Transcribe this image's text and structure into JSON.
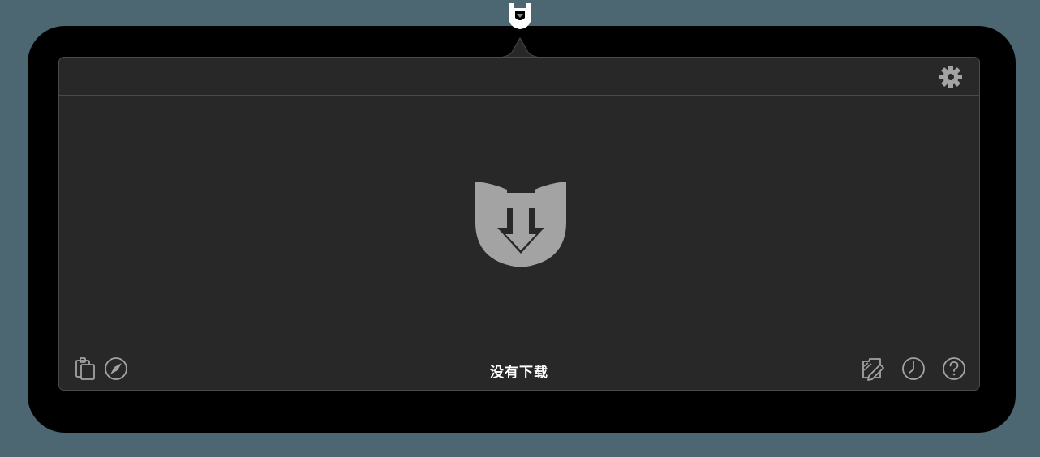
{
  "app": {
    "tray_icon": "downie-shield-icon",
    "colors": {
      "panel_bg": "#282828",
      "border": "#4a4a4a",
      "icon_gray": "#a3a3a3",
      "text": "#ffffff",
      "desktop": "#4c6772"
    }
  },
  "header": {
    "settings_icon": "gear-icon"
  },
  "main": {
    "empty_state_icon": "shield-download-icon"
  },
  "footer": {
    "left_buttons": [
      "clipboard-icon",
      "safari-compass-icon"
    ],
    "status_text": "没有下载",
    "right_buttons": [
      "post-processing-icon",
      "history-clock-icon",
      "help-icon"
    ]
  }
}
